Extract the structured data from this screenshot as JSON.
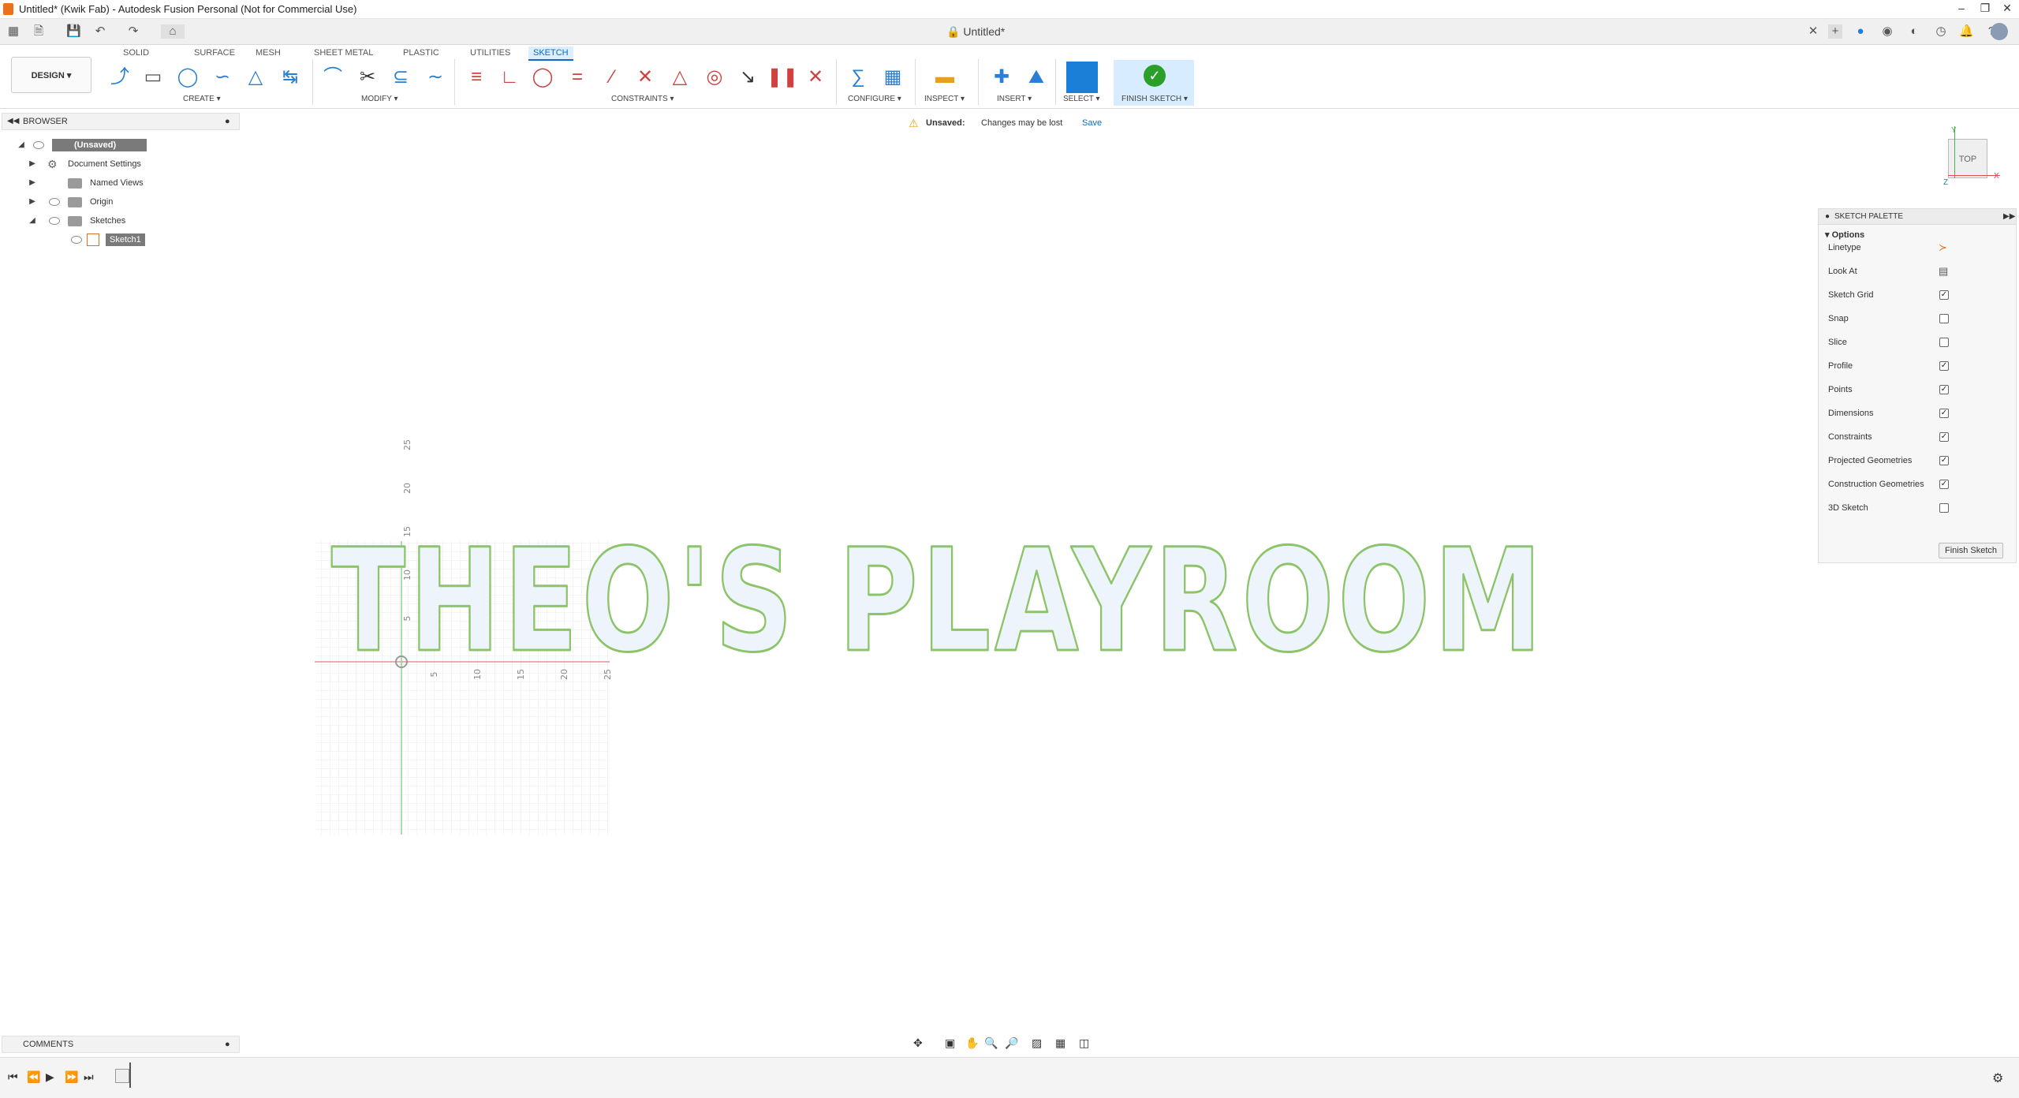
{
  "window": {
    "title": "Untitled* (Kwik Fab) - Autodesk Fusion Personal (Not for Commercial Use)",
    "document_tab": "Untitled*"
  },
  "ribbon": {
    "workspace": "DESIGN",
    "tabs": [
      "SOLID",
      "SURFACE",
      "MESH",
      "SHEET METAL",
      "PLASTIC",
      "UTILITIES",
      "SKETCH"
    ],
    "active_tab": "SKETCH",
    "groups": {
      "create": "CREATE",
      "modify": "MODIFY",
      "constraints": "CONSTRAINTS",
      "configure": "CONFIGURE",
      "inspect": "INSPECT",
      "insert": "INSERT",
      "select": "SELECT",
      "finish": "FINISH SKETCH"
    }
  },
  "browser": {
    "header": "BROWSER",
    "root": "(Unsaved)",
    "items": [
      "Document Settings",
      "Named Views",
      "Origin",
      "Sketches",
      "Sketch1"
    ]
  },
  "banner": {
    "label": "Unsaved:",
    "message": "Changes may be lost",
    "save": "Save"
  },
  "viewcube": {
    "face": "TOP",
    "axes": {
      "x": "X",
      "y": "Y",
      "z": "Z"
    }
  },
  "sketch": {
    "text": "THEO'S PLAYROOM",
    "x_ticks": [
      "5",
      "10",
      "15",
      "20",
      "25"
    ],
    "y_ticks": [
      "5",
      "10",
      "15",
      "20",
      "25"
    ]
  },
  "palette": {
    "title": "SKETCH PALETTE",
    "section": "Options",
    "rows": [
      {
        "label": "Linetype"
      },
      {
        "label": "Look At"
      },
      {
        "label": "Sketch Grid",
        "checked": true
      },
      {
        "label": "Snap",
        "checked": false
      },
      {
        "label": "Slice",
        "checked": false
      },
      {
        "label": "Profile",
        "checked": true
      },
      {
        "label": "Points",
        "checked": true
      },
      {
        "label": "Dimensions",
        "checked": true
      },
      {
        "label": "Constraints",
        "checked": true
      },
      {
        "label": "Projected Geometries",
        "checked": true
      },
      {
        "label": "Construction Geometries",
        "checked": true
      },
      {
        "label": "3D Sketch",
        "checked": false
      }
    ],
    "finish_button": "Finish Sketch"
  },
  "comments": {
    "header": "COMMENTS"
  }
}
